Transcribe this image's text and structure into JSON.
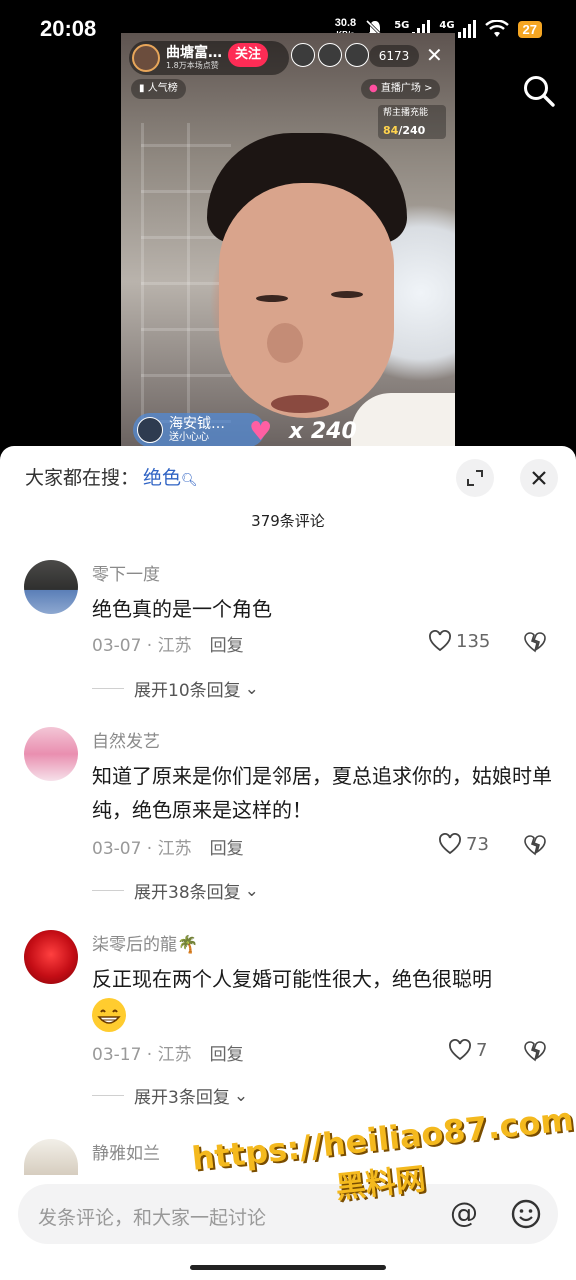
{
  "status_bar": {
    "time": "20:08",
    "net_speed_value": "30.8",
    "net_speed_unit": "KB/s",
    "sig_5g": "5G",
    "sig_4g": "4G",
    "battery": "27"
  },
  "live": {
    "host_name": "曲塘富…",
    "host_likes": "1.8万本场点赞",
    "follow_label": "关注",
    "viewer_count": "6173",
    "rank_label": "人气榜",
    "plaza_label": "直播广场 >",
    "charge_title": "帮主播充能",
    "charge_current": "84",
    "charge_total": "/240",
    "gift_user": "海安钺…",
    "gift_desc": "送小心心",
    "gift_count": "x 240"
  },
  "panel": {
    "search_prefix": "大家都在搜：",
    "search_term": "绝色",
    "comment_count": "379条评论"
  },
  "comments": [
    {
      "name": "零下一度",
      "text": "绝色真的是一个角色",
      "date": "03-07",
      "location": "江苏",
      "reply": "回复",
      "likes": "135",
      "expand": "展开10条回复"
    },
    {
      "name": "自然发艺",
      "text": "知道了原来是你们是邻居，夏总追求你的，姑娘时单纯，绝色原来是这样的！",
      "date": "03-07",
      "location": "江苏",
      "reply": "回复",
      "likes": "73",
      "expand": "展开38条回复"
    },
    {
      "name": "柒零后的龍🌴",
      "text": "反正现在两个人复婚可能性很大，绝色很聪明",
      "date": "03-17",
      "location": "江苏",
      "reply": "回复",
      "likes": "7",
      "expand": "展开3条回复"
    },
    {
      "name": "静雅如兰"
    }
  ],
  "input": {
    "placeholder": "发条评论，和大家一起讨论"
  },
  "watermark": {
    "url": "https://heiliao87.com",
    "name": "黑料网"
  }
}
